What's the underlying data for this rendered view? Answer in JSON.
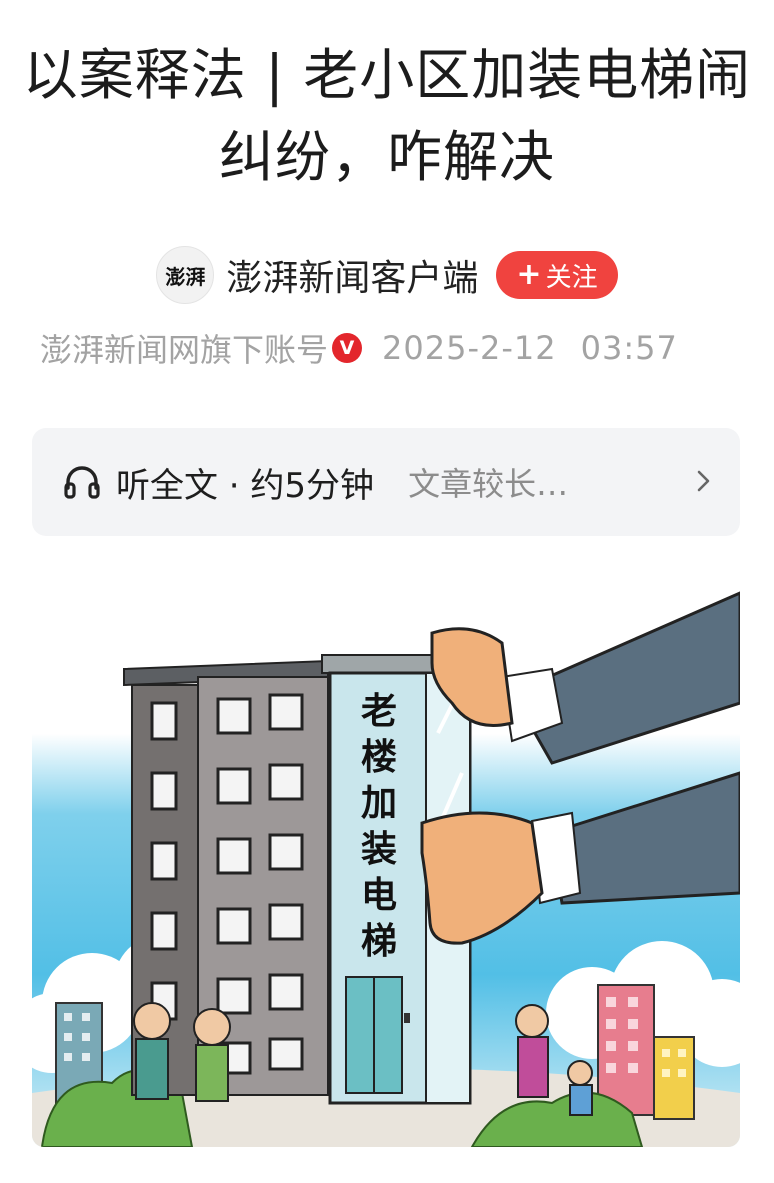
{
  "article": {
    "title": "以案释法 | 老小区加装电梯闹纠纷，咋解决"
  },
  "author": {
    "avatar_text": "澎湃",
    "name": "澎湃新闻客户端",
    "follow_label": "关注",
    "affiliation": "澎湃新闻网旗下账号",
    "verified_badge": "V",
    "date": "2025-2-12",
    "time": "03:57"
  },
  "listen": {
    "icon": "headphones-icon",
    "label": "听全文 · 约5分钟",
    "hint": "文章较长…",
    "chevron_icon": "chevron-right-icon"
  },
  "cover": {
    "sign_text": "老楼加装电梯"
  },
  "colors": {
    "follow_bg": "#f0433f",
    "verified_badge": "#e3262c",
    "listen_bg": "#f3f4f6",
    "meta_text": "#a3a3a3"
  }
}
